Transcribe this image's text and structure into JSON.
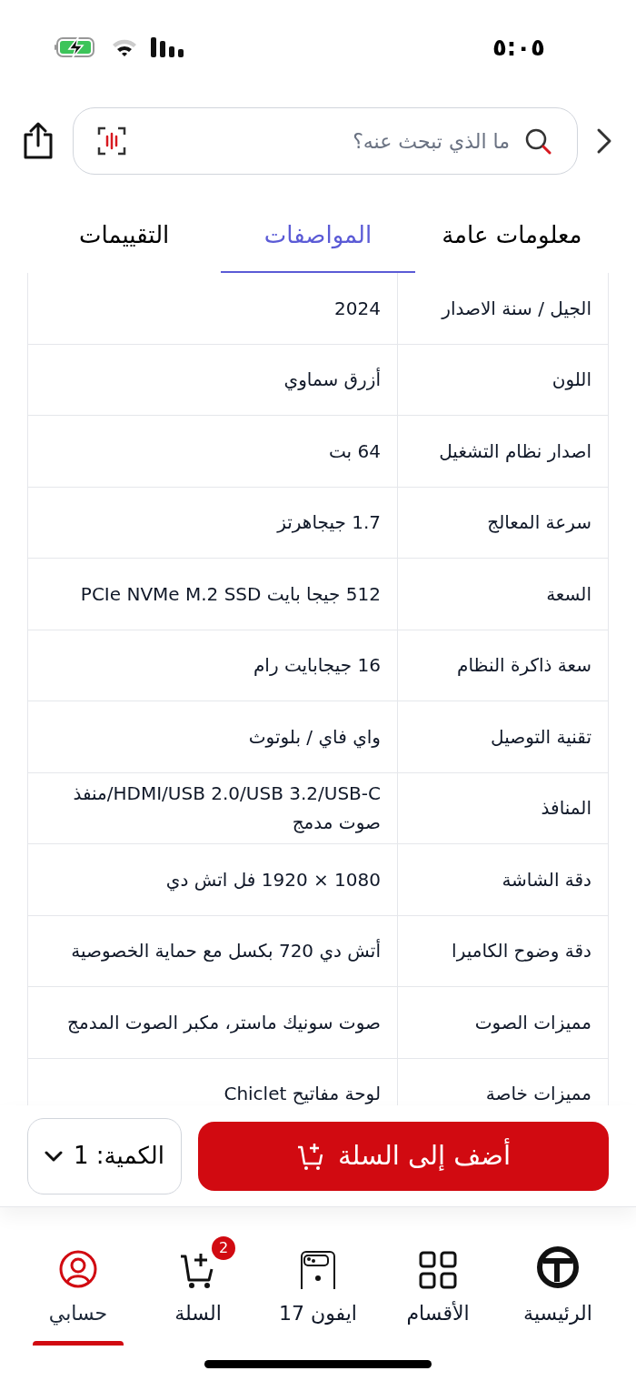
{
  "status_bar": {
    "time": "٥:٠٥"
  },
  "search": {
    "placeholder": "ما الذي تبحث عنه؟"
  },
  "tabs": [
    {
      "label": "معلومات عامة",
      "selected": false
    },
    {
      "label": "المواصفات",
      "selected": true
    },
    {
      "label": "التقييمات",
      "selected": false
    }
  ],
  "specs": [
    {
      "label": "الجيل / سنة الاصدار",
      "value": "2024"
    },
    {
      "label": "اللون",
      "value": "أزرق سماوي"
    },
    {
      "label": "اصدار نظام التشغيل",
      "value": "64 بت"
    },
    {
      "label": "سرعة المعالج",
      "value": "1.7 جيجاهرتز"
    },
    {
      "label": "السعة",
      "value": "512 جيجا بايت PCIe NVMe M.2 SSD"
    },
    {
      "label": "سعة ذاكرة النظام",
      "value": "16 جيجابايت رام"
    },
    {
      "label": "تقنية التوصيل",
      "value": "واي فاي / بلوتوث"
    },
    {
      "label": "المنافذ",
      "value": "HDMI/USB 2.0/USB 3.2/USB-C/منفذ صوت مدمج"
    },
    {
      "label": "دقة الشاشة",
      "value": "1080 × 1920 فل اتش دي"
    },
    {
      "label": "دقة وضوح الكاميرا",
      "value": "أتش دي 720 بكسل مع حماية الخصوصية"
    },
    {
      "label": "مميزات الصوت",
      "value": "صوت سونيك ماستر، مكبر الصوت المدمج"
    },
    {
      "label": "مميزات خاصة",
      "value": "لوحة مفاتيح Chiclet"
    }
  ],
  "add_to_cart": {
    "label": "أضف إلى السلة"
  },
  "quantity": {
    "label": "الكمية: 1"
  },
  "nav": [
    {
      "kind": "home",
      "label": "الرئيسية",
      "selected": false
    },
    {
      "kind": "categories",
      "label": "الأقسام",
      "selected": false
    },
    {
      "kind": "phone",
      "label": "ايفون 17",
      "selected": false
    },
    {
      "kind": "cart",
      "label": "السلة",
      "selected": false,
      "badge": "2"
    },
    {
      "kind": "account",
      "label": "حسابي",
      "selected": true
    }
  ]
}
